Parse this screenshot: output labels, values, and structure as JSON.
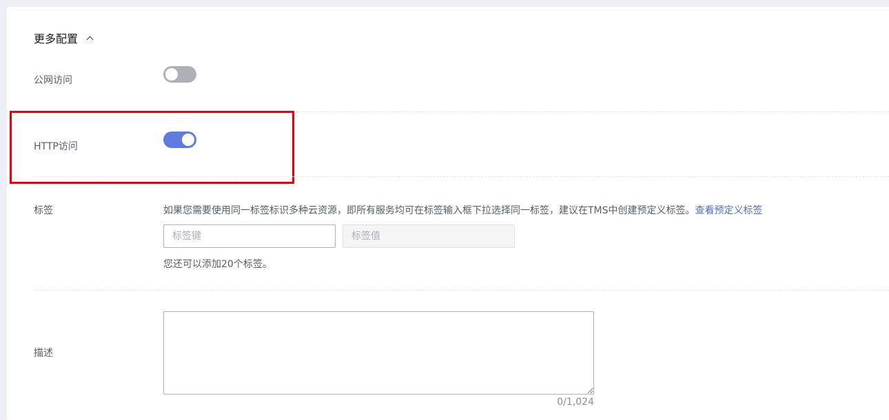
{
  "section": {
    "title": "更多配置",
    "chevron_icon": "chevron-up-icon"
  },
  "public_access": {
    "label": "公网访问",
    "enabled": false
  },
  "http_access": {
    "label": "HTTP访问",
    "enabled": true
  },
  "tags": {
    "label": "标签",
    "hint": "如果您需要使用同一标签标识多种云资源，即所有服务均可在标签输入框下拉选择同一标签，建议在TMS中创建预定义标签。",
    "hint_link": "查看预定义标签",
    "key_placeholder": "标签键",
    "value_placeholder": "标签值",
    "remaining": "您还可以添加20个标签。"
  },
  "description": {
    "label": "描述",
    "value": "",
    "counter": "0/1,024"
  },
  "colors": {
    "switch_on": "#5e7ce0",
    "switch_off": "#adb0b8",
    "link": "#526ecc",
    "highlight": "#e3050c"
  }
}
